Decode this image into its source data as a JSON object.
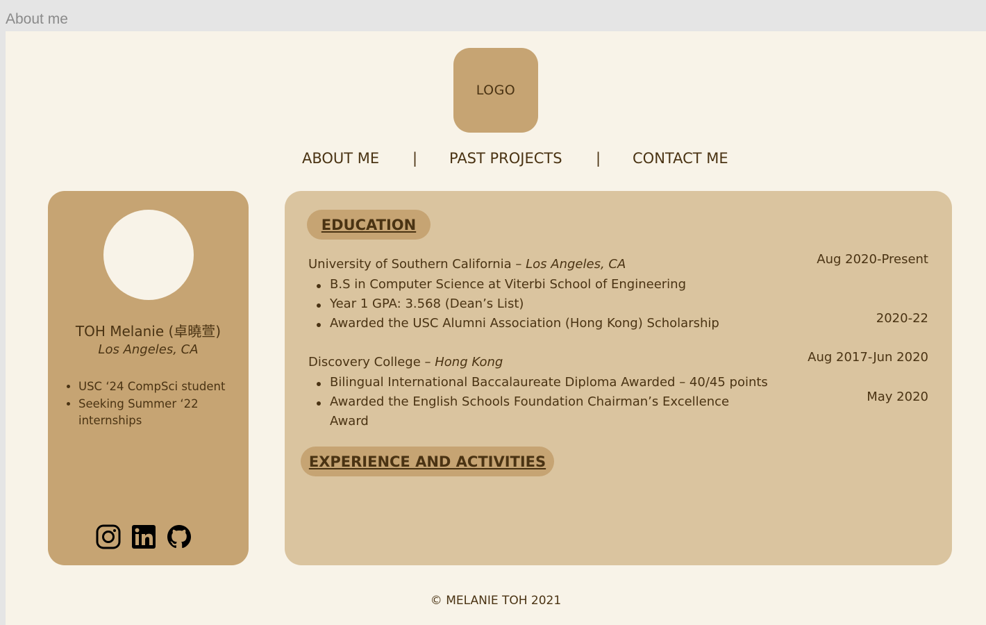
{
  "frame": {
    "label": "About me"
  },
  "logo": {
    "text": "LOGO"
  },
  "nav": {
    "items": [
      "ABOUT ME",
      "PAST PROJECTS",
      "CONTACT ME"
    ],
    "separator": "|"
  },
  "profile": {
    "name": "TOH Melanie (卓曉萱)",
    "location": "Los Angeles, CA",
    "bullets": [
      "USC ‘24 CompSci student",
      "Seeking Summer ‘22 internships"
    ],
    "socials": [
      "instagram-icon",
      "linkedin-icon",
      "github-icon"
    ]
  },
  "education": {
    "heading": "EDUCATION",
    "schools": [
      {
        "name": "University of Southern California – ",
        "place": "Los Angeles, CA",
        "date": "Aug 2020-Present",
        "bullets": [
          "B.S in Computer Science at Viterbi School of Engineering",
          "Year 1 GPA: 3.568 (Dean’s List)",
          "Awarded the USC Alumni Association (Hong Kong) Scholarship"
        ],
        "bullet_date": "2020-22"
      },
      {
        "name": "Discovery College – ",
        "place": "Hong Kong",
        "date": "Aug 2017-Jun 2020",
        "bullets": [
          "Bilingual International Baccalaureate Diploma Awarded – 40/45 points",
          "Awarded the English Schools Foundation Chairman’s Excellence",
          "Award"
        ],
        "bullet_date": "May 2020"
      }
    ]
  },
  "experience": {
    "heading": "EXPERIENCE AND ACTIVITIES"
  },
  "footer": {
    "text": "© MELANIE TOH 2021"
  },
  "colors": {
    "background": "#f8f3e8",
    "card_dark": "#c6a473",
    "card_light": "#dac49f",
    "text": "#4a3313"
  }
}
